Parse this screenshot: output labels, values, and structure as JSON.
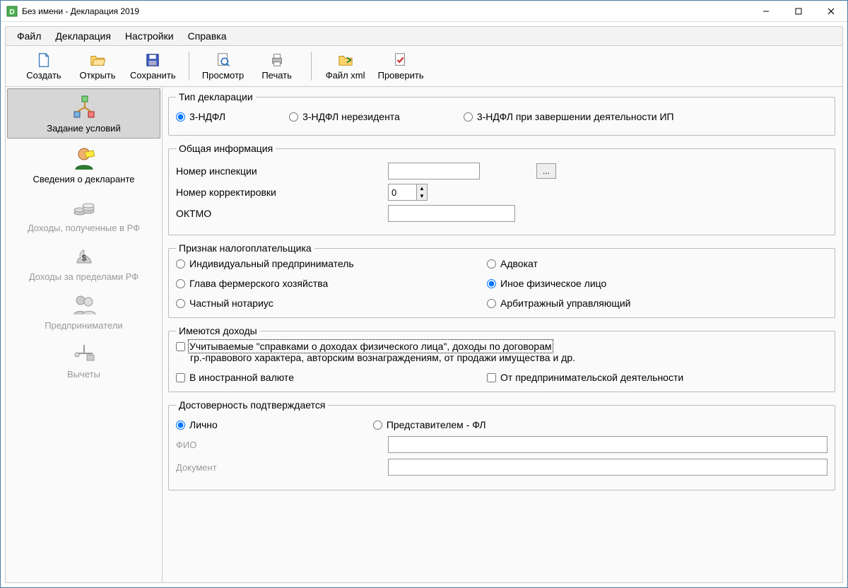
{
  "window": {
    "title": "Без имени - Декларация 2019"
  },
  "menu": {
    "file": "Файл",
    "declaration": "Декларация",
    "settings": "Настройки",
    "help": "Справка"
  },
  "toolbar": {
    "create": "Создать",
    "open": "Открыть",
    "save": "Сохранить",
    "preview": "Просмотр",
    "print": "Печать",
    "file_xml": "Файл xml",
    "check": "Проверить"
  },
  "sidebar": {
    "conditions": "Задание условий",
    "declarant": "Сведения о декларанте",
    "income_rf": "Доходы, полученные в РФ",
    "income_abroad": "Доходы за пределами РФ",
    "entrepreneurs": "Предприниматели",
    "deductions": "Вычеты"
  },
  "groups": {
    "decl_type": {
      "legend": "Тип декларации",
      "r1": "3-НДФЛ",
      "r2": "3-НДФЛ нерезидента",
      "r3": "3-НДФЛ при завершении деятельности ИП"
    },
    "general": {
      "legend": "Общая информация",
      "inspection": "Номер инспекции",
      "browse": "...",
      "correction": "Номер корректировки",
      "correction_value": "0",
      "oktmo": "ОКТМО"
    },
    "taxpayer": {
      "legend": "Признак налогоплательщика",
      "r1": "Индивидуальный предприниматель",
      "r2": "Адвокат",
      "r3": "Глава фермерского хозяйства",
      "r4": "Иное физическое лицо",
      "r5": "Частный нотариус",
      "r6": "Арбитражный управляющий"
    },
    "income": {
      "legend": "Имеются доходы",
      "c1": "Учитываемые \"справками о доходах физического лица\", доходы по договорам",
      "c1_sub": "гр.-правового характера, авторским вознаграждениям, от продажи имущества и др.",
      "c2": "В иностранной валюте",
      "c3": "От предпринимательской деятельности"
    },
    "confirm": {
      "legend": "Достоверность подтверждается",
      "r1": "Лично",
      "r2": "Представителем - ФЛ",
      "fio": "ФИО",
      "doc": "Документ"
    }
  }
}
